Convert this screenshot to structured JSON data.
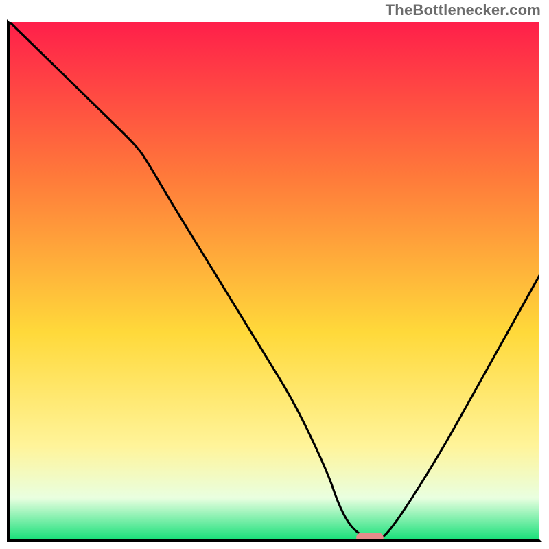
{
  "attribution": "TheBottlenecker.com",
  "colors": {
    "gradient_top": "#ff1f4a",
    "gradient_mid_upper": "#ff7a3a",
    "gradient_mid": "#ffd93a",
    "gradient_mid_lower": "#fff49a",
    "gradient_lower": "#e9ffe0",
    "gradient_bottom": "#19e07a",
    "curve": "#000000",
    "marker_fill": "#e58b8b",
    "marker_stroke": "#e58b8b",
    "axis": "#000000"
  },
  "chart_data": {
    "type": "line",
    "title": "",
    "xlabel": "",
    "ylabel": "",
    "xlim": [
      0,
      100
    ],
    "ylim": [
      0,
      100
    ],
    "x": [
      0,
      6,
      12,
      18,
      24,
      26,
      30,
      36,
      42,
      48,
      54,
      60,
      62,
      64,
      66,
      68,
      70,
      72,
      76,
      82,
      88,
      94,
      100
    ],
    "values": [
      100,
      94,
      88,
      82,
      76,
      73,
      66,
      56,
      46,
      36,
      26,
      13,
      7,
      3,
      1,
      0,
      0,
      2,
      8,
      18,
      29,
      40,
      51
    ],
    "optimum_marker": {
      "x": 68,
      "width": 5,
      "y": 0
    }
  }
}
